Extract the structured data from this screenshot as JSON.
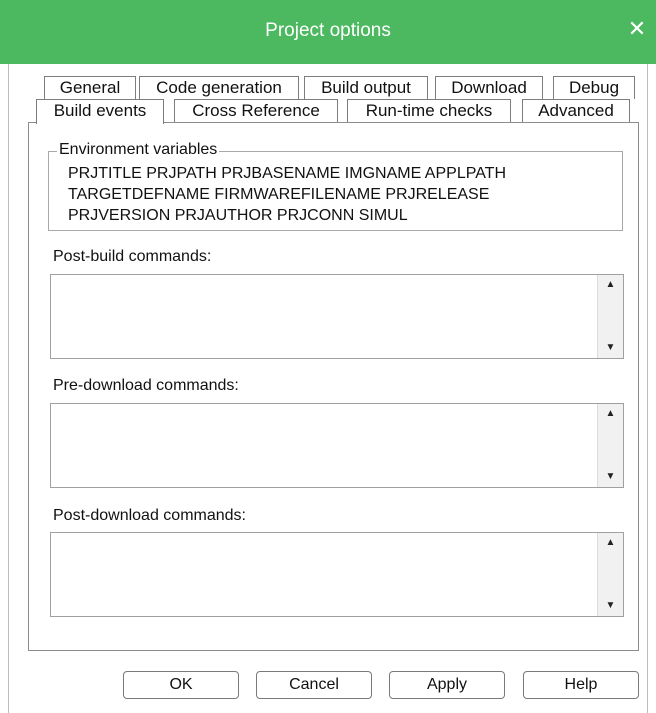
{
  "window": {
    "title": "Project options"
  },
  "tabs_row1": [
    "General",
    "Code generation",
    "Build output",
    "Download",
    "Debug"
  ],
  "tabs_row2": [
    "Build events",
    "Cross Reference",
    "Run-time checks",
    "Advanced"
  ],
  "active_tab": "Build events",
  "environment": {
    "legend": "Environment variables",
    "lines": [
      "PRJTITLE PRJPATH PRJBASENAME IMGNAME APPLPATH",
      "TARGETDEFNAME FIRMWAREFILENAME PRJRELEASE",
      "PRJVERSION PRJAUTHOR PRJCONN SIMUL"
    ]
  },
  "post_build": {
    "label": "Post-build commands:",
    "value": ""
  },
  "pre_download": {
    "label": "Pre-download commands:",
    "value": ""
  },
  "post_download": {
    "label": "Post-download commands:",
    "value": ""
  },
  "buttons": {
    "ok": "OK",
    "cancel": "Cancel",
    "apply": "Apply",
    "help": "Help"
  },
  "colors": {
    "titlebar": "#4cb860",
    "title_text": "#ffffff"
  },
  "icons": {
    "close": "close-icon",
    "scroll_up": "arrow-up-icon",
    "scroll_down": "arrow-down-icon"
  }
}
